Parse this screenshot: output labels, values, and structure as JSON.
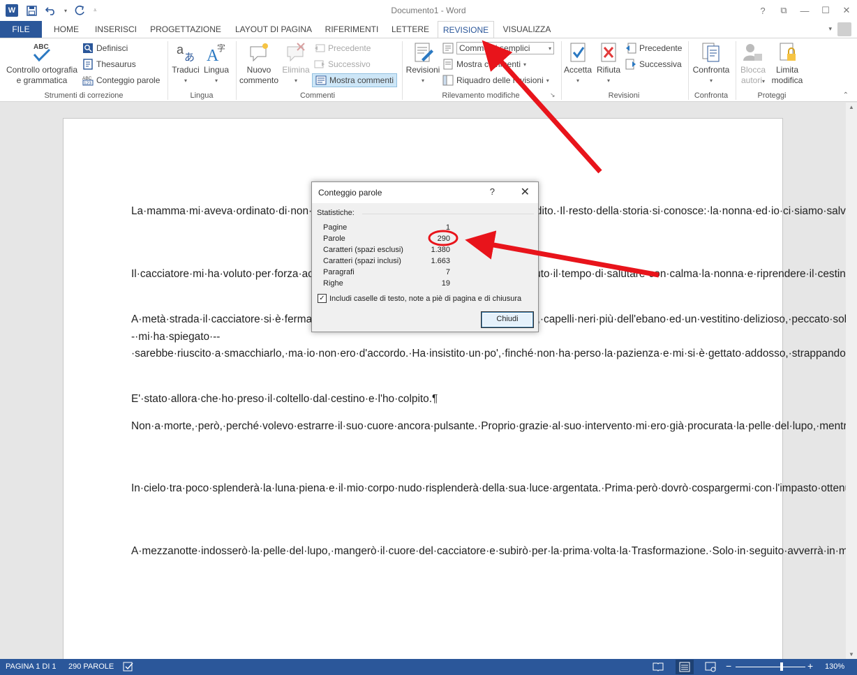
{
  "window": {
    "title": "Documento1 - Word",
    "controls": {
      "help": "?",
      "restore": "⧉",
      "minimize": "—",
      "maximize": "☐",
      "close": "✕"
    },
    "word_logo": "W"
  },
  "tabs": [
    {
      "label": "FILE"
    },
    {
      "label": "HOME"
    },
    {
      "label": "INSERISCI"
    },
    {
      "label": "PROGETTAZIONE"
    },
    {
      "label": "LAYOUT DI PAGINA"
    },
    {
      "label": "RIFERIMENTI"
    },
    {
      "label": "LETTERE"
    },
    {
      "label": "REVISIONE"
    },
    {
      "label": "VISUALIZZA"
    }
  ],
  "active_tab": "REVISIONE",
  "ribbon": {
    "proofing": {
      "spelling_line1": "Controllo ortografia",
      "spelling_line2": "e grammatica",
      "spelling_icon_text": "ABC",
      "define": "Definisci",
      "thesaurus": "Thesaurus",
      "wordcount": "Conteggio parole",
      "group": "Strumenti di correzione"
    },
    "language": {
      "translate": "Traduci",
      "language": "Lingua",
      "group": "Lingua"
    },
    "comments": {
      "new_line1": "Nuovo",
      "new_line2": "commento",
      "delete": "Elimina",
      "previous": "Precedente",
      "next": "Successivo",
      "show": "Mostra commenti",
      "group": "Commenti"
    },
    "tracking": {
      "track": "Revisioni",
      "markup_select": "Commenti semplici",
      "show_markup": "Mostra commenti",
      "review_pane": "Riquadro delle revisioni",
      "group": "Rilevamento modifiche"
    },
    "changes": {
      "accept": "Accetta",
      "reject": "Rifiuta",
      "previous": "Precedente",
      "next": "Successiva",
      "group": "Revisioni"
    },
    "compare": {
      "compare": "Confronta",
      "group": "Confronta"
    },
    "protect": {
      "block_line1": "Blocca",
      "block_line2": "autori",
      "restrict_line1": "Limita",
      "restrict_line2": "modifica",
      "group": "Proteggi"
    }
  },
  "document": {
    "paragraphs": [
      "La·mamma·mi·aveva·ordinato·di·non·parlare·con·gli·sconosciuti,·ma·io·le·ho·disubbidito.·Il·resto·della·storia·si·conosce:·la·nonna·ed·io·ci·siamo·salvate·grazie·al·cacciatore.·Adesso·la·nonna·sta·mangiando·le·sue·focacce,·mentre·io·sono·qui.¶",
      "Il·cacciatore·mi·ha·voluto·per·forza·accompagnare,·voleva·portarmi·fuori,·così·ho·avuto·il·tempo·di·salutare·con·calma·la·nonna·e·riprendere·il·cestino,·poi·insieme·siamo·entrati·nel·bosco.¶",
      "A·metà·strada·il·cacciatore·si·è·fermato·e·mi·ha·detto·che·ho·dei·capelli·meravigliosi,·capelli·neri·più·dell'ebano·ed·un·vestitino·delizioso,·peccato·solo·che·si·fosse·sporcato·di·sangue.·Se·me·lo·fossi·tolto·--·mi·ha·spiegato·--·sarebbe·riuscito·a·smacchiarlo,·ma·io·non·ero·d'accordo.·Ha·insistito·un·po',·finché·non·ha·perso·la·pazienza·e·mi·si·è·gettato·addosso,·strappandomi·la·mantellina·rossa.¶",
      "E'·stato·allora·che·ho·preso·il·coltello·dal·cestino·e·l'ho·colpito.¶",
      "Non·a·morte,·però,·perché·volevo·estrarre·il·suo·cuore·ancora·pulsante.·Proprio·grazie·al·suo·intervento·mi·ero·già·procurata·la·pelle·del·lupo,·mentre·prima·di·arrivare·a·casa·dalla·nonna·avevo·raccolto·la·radice·di·mandragora·e·l'ortica.¶",
      "In·cielo·tra·poco·splenderà·la·luna·piena·e·il·mio·corpo·nudo·risplenderà·della·sua·luce·argentata.·Prima·però·dovrò·cospargermi·con·l'impasto·ottenuto·mischiando·la·mandragora·e·l'ortica·al·sangue·puro·di·un·neonato.¶",
      "A·mezzanotte·indosserò·la·pelle·del·lupo,·mangerò·il·cuore·del·cacciatore·e·subirò·per·la·prima·volta·la·Trasformazione.·Solo·in·seguito·avverrà·in·modo·naturale,·così·finalmente·ad·ogni·Plenilunio·potrò·affiancare·nella·caccia·i·miei·Fratelli·e·Sorelle.¶"
    ]
  },
  "dialog": {
    "title": "Conteggio parole",
    "help": "?",
    "close": "✕",
    "section": "Statistiche:",
    "stats": [
      {
        "label": "Pagine",
        "value": "1"
      },
      {
        "label": "Parole",
        "value": "290"
      },
      {
        "label": "Caratteri (spazi esclusi)",
        "value": "1.380"
      },
      {
        "label": "Caratteri (spazi inclusi)",
        "value": "1.663"
      },
      {
        "label": "Paragrafi",
        "value": "7"
      },
      {
        "label": "Righe",
        "value": "19"
      }
    ],
    "checkbox_label": "Includi caselle di testo, note a piè di pagina e di chiusura",
    "checkbox_checked": true,
    "close_button": "Chiudi"
  },
  "statusbar": {
    "page": "PAGINA 1 DI 1",
    "words": "290 PAROLE",
    "zoom": "130%",
    "zoom_minus": "−",
    "zoom_plus": "+"
  },
  "colors": {
    "accent": "#2b579a",
    "annotation": "#e8141b"
  }
}
